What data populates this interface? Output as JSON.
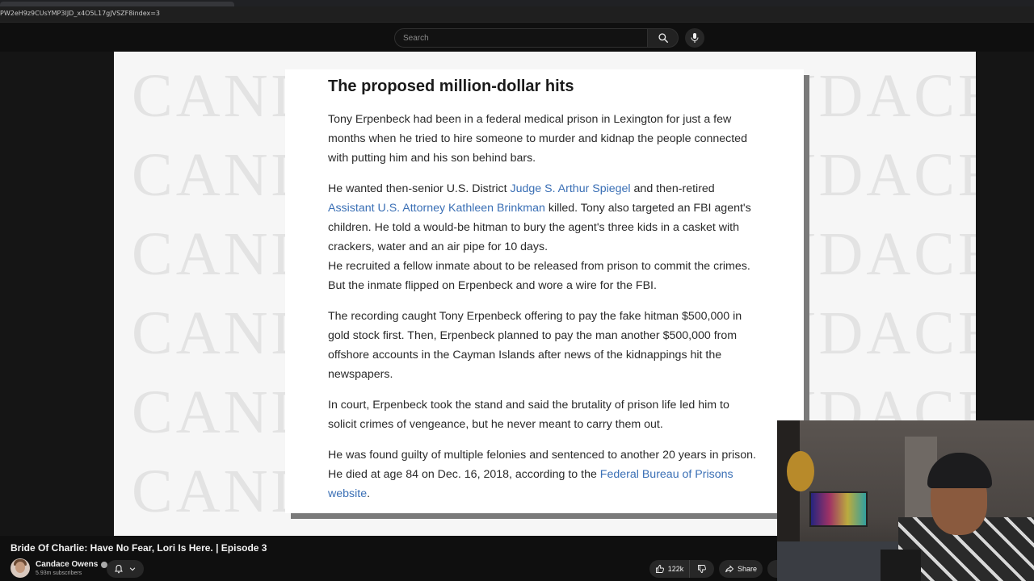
{
  "browser": {
    "url": "PW2eH9z9CUsYMP3IJD_x4O5L17gJVSZF8index=3"
  },
  "youtube": {
    "search_placeholder": "Search",
    "search_icon": "search-icon",
    "mic_icon": "microphone-icon"
  },
  "slide": {
    "watermark": "CANDACE",
    "heading": "The proposed million-dollar hits",
    "paragraphs": {
      "p1": "Tony Erpenbeck had been in a federal medical prison in Lexington for just a few months when he tried to hire someone to murder and kidnap the people connected with putting him and his son behind bars.",
      "p2_before": "He wanted then-senior U.S. District ",
      "p2_link1": "Judge S. Arthur Spiegel",
      "p2_mid": " and then-retired ",
      "p2_link2": "Assistant U.S. Attorney Kathleen Brinkman",
      "p2_after": " killed. Tony also targeted an FBI agent's children. He told a would-be hitman to bury the agent's three kids in a casket with crackers, water and an air pipe for 10 days.",
      "p3": "He recruited a fellow inmate about to be released from prison to commit the crimes. But the inmate flipped on Erpenbeck and wore a wire for the FBI.",
      "p4": "The recording caught Tony Erpenbeck offering to pay the fake hitman $500,000 in gold stock first. Then, Erpenbeck planned to pay the man another $500,000 from offshore accounts in the Cayman Islands after news of the kidnappings hit the newspapers.",
      "p5": "In court, Erpenbeck took the stand and said the brutality of prison life led him to solicit crimes of vengeance, but he never meant to carry them out.",
      "p6_before": "He was found guilty of multiple felonies and sentenced to another 20 years in prison. He died at age 84 on Dec. 16, 2018, according to the ",
      "p6_link": "Federal Bureau of Prisons website",
      "p6_after": "."
    },
    "link_color": "#3a6fb5"
  },
  "video": {
    "title": "Bride Of Charlie: Have No Fear, Lori Is Here. | Episode 3",
    "channel": "Candace Owens",
    "subscribers": "5.93m subscribers",
    "likes": "122k",
    "share_label": "Share"
  }
}
